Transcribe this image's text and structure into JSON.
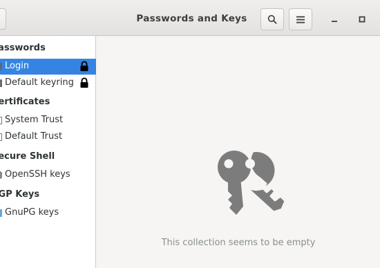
{
  "window": {
    "title": "Passwords and Keys"
  },
  "header": {
    "search_button_icon": "search-icon",
    "menu_button_icon": "hamburger-menu-icon",
    "minimize_icon": "minimize-icon",
    "maximize_icon": "maximize-icon"
  },
  "sidebar": {
    "sections": [
      {
        "title": "Passwords",
        "items": [
          {
            "label": "Login",
            "icon": "keyring-icon",
            "locked": true,
            "selected": true
          },
          {
            "label": "Default keyring",
            "icon": "keyring-icon",
            "locked": true,
            "selected": false
          }
        ]
      },
      {
        "title": "Certificates",
        "items": [
          {
            "label": "System Trust",
            "icon": "certificate-icon"
          },
          {
            "label": "Default Trust",
            "icon": "certificate-icon"
          }
        ]
      },
      {
        "title": "Secure Shell",
        "items": [
          {
            "label": "OpenSSH keys",
            "icon": "ssh-key-icon"
          }
        ]
      },
      {
        "title": "PGP Keys",
        "items": [
          {
            "label": "GnuPG keys",
            "icon": "gpg-key-icon"
          }
        ]
      }
    ]
  },
  "main": {
    "empty_icon": "keys-icon",
    "empty_message": "This collection seems to be empty"
  },
  "colors": {
    "selection": "#3584e4",
    "icon_gray": "#7a7a7a",
    "empty_text": "#8b8e8f"
  }
}
